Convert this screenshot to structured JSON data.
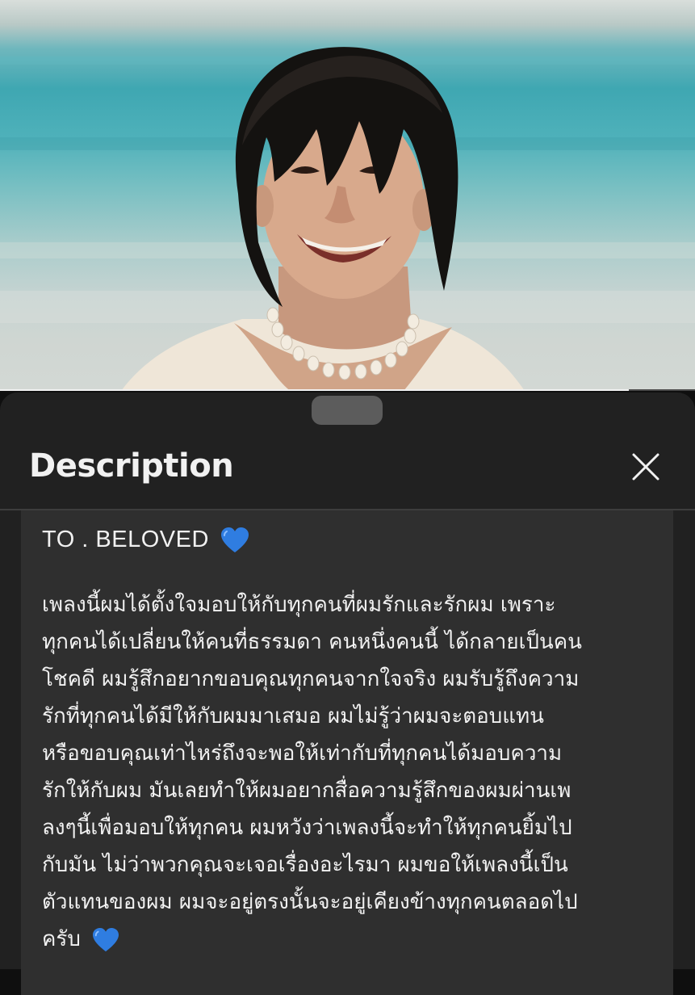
{
  "player": {
    "progress_fraction": 0.905,
    "thumbnail_description": "smiling young man with wet dark hair and a shell necklace in front of a turquoise sea"
  },
  "sheet": {
    "title": "Description",
    "close_icon": "close-icon"
  },
  "description": {
    "title": "TO . BELOVED",
    "title_emoji": "blue-heart-icon",
    "lines": [
      "เพลงนี้ผมได้ตั้งใจมอบให้กับทุกคนที่ผมรักและรักผม เพราะ",
      "ทุกคนได้เปลี่ยนให้คนที่ธรรมดา คนหนึ่งคนนี้ ได้กลายเป็นคน",
      "โชคดี ผมรู้สึกอยากขอบคุณทุกคนจากใจจริง ผมรับรู้ถึงความ",
      "รักที่ทุกคนได้มีให้กับผมมาเสมอ ผมไม่รู้ว่าผมจะตอบแทน",
      "หรือขอบคุณเท่าไหร่ถึงจะพอให้เท่ากับที่ทุกคนได้มอบความ",
      "รักให้กับผม มันเลยทำให้ผมอยากสื่อความรู้สึกของผมผ่านเพ",
      "ลงๆนี้เพื่อมอบให้ทุกคน ผมหวังว่าเพลงนี้จะทำให้ทุกคนยิ้มไป",
      "กับมัน ไม่ว่าพวกคุณจะเจอเรื่องอะไรมา ผมขอให้เพลงนี้เป็น",
      "ตัวแทนของผม ผมจะอยู่ตรงนั้นจะอยู่เคียงข้างทุกคนตลอดไป",
      "ครับ"
    ],
    "end_emoji": "blue-heart-icon"
  },
  "colors": {
    "sheet_bg": "#212121",
    "card_bg": "#2f2f2f",
    "text": "#f1f1f1",
    "heart": "#2f7de1"
  }
}
